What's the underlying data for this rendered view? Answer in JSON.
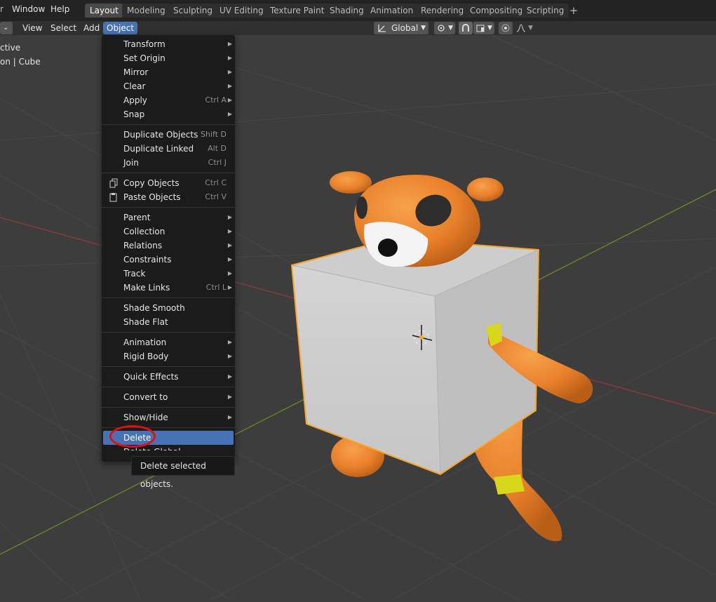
{
  "topbar": {
    "menus": [
      "Window",
      "Help"
    ],
    "workspaces": [
      "Layout",
      "Modeling",
      "Sculpting",
      "UV Editing",
      "Texture Paint",
      "Shading",
      "Animation",
      "Rendering",
      "Compositing",
      "Scripting"
    ],
    "active_workspace": "Layout",
    "add_tab": "+"
  },
  "viewport_header": {
    "mode_chevron": "⌄",
    "view": "View",
    "select": "Select",
    "add": "Add",
    "object": "Object",
    "orientation": "Global"
  },
  "overlay": {
    "line1": "ctive",
    "line2": "on | Cube"
  },
  "object_menu": {
    "items": [
      {
        "label": "Transform",
        "shortcut": "",
        "submenu": true
      },
      {
        "label": "Set Origin",
        "shortcut": "",
        "submenu": true
      },
      {
        "label": "Mirror",
        "shortcut": "",
        "submenu": true
      },
      {
        "label": "Clear",
        "shortcut": "",
        "submenu": true
      },
      {
        "label": "Apply",
        "shortcut": "Ctrl A",
        "submenu": true
      },
      {
        "label": "Snap",
        "shortcut": "",
        "submenu": true
      },
      {
        "label": "Duplicate Objects",
        "shortcut": "Shift D",
        "submenu": false
      },
      {
        "label": "Duplicate Linked",
        "shortcut": "Alt D",
        "submenu": false
      },
      {
        "label": "Join",
        "shortcut": "Ctrl J",
        "submenu": false
      },
      {
        "label": "Copy Objects",
        "shortcut": "Ctrl C",
        "submenu": false,
        "icon": "copy-icon"
      },
      {
        "label": "Paste Objects",
        "shortcut": "Ctrl V",
        "submenu": false,
        "icon": "paste-icon"
      },
      {
        "label": "Parent",
        "shortcut": "",
        "submenu": true
      },
      {
        "label": "Collection",
        "shortcut": "",
        "submenu": true
      },
      {
        "label": "Relations",
        "shortcut": "",
        "submenu": true
      },
      {
        "label": "Constraints",
        "shortcut": "",
        "submenu": true
      },
      {
        "label": "Track",
        "shortcut": "",
        "submenu": true
      },
      {
        "label": "Make Links",
        "shortcut": "Ctrl L",
        "submenu": true
      },
      {
        "label": "Shade Smooth",
        "shortcut": "",
        "submenu": false
      },
      {
        "label": "Shade Flat",
        "shortcut": "",
        "submenu": false
      },
      {
        "label": "Animation",
        "shortcut": "",
        "submenu": true
      },
      {
        "label": "Rigid Body",
        "shortcut": "",
        "submenu": true
      },
      {
        "label": "Quick Effects",
        "shortcut": "",
        "submenu": true
      },
      {
        "label": "Convert to",
        "shortcut": "",
        "submenu": true
      },
      {
        "label": "Show/Hide",
        "shortcut": "",
        "submenu": true
      },
      {
        "label": "Delete",
        "shortcut": "",
        "submenu": false,
        "highlighted": true
      },
      {
        "label": "Delete Global",
        "shortcut": "",
        "submenu": false
      }
    ],
    "submenu_arrow": "▶"
  },
  "tooltip": {
    "text": "Delete selected objects."
  },
  "colors": {
    "accent": "#4772b3",
    "menu_bg": "#1b1b1b",
    "viewport_bg": "#3d3d3d",
    "selection_outline": "#f5a623",
    "annotation_circle": "#e01010"
  }
}
